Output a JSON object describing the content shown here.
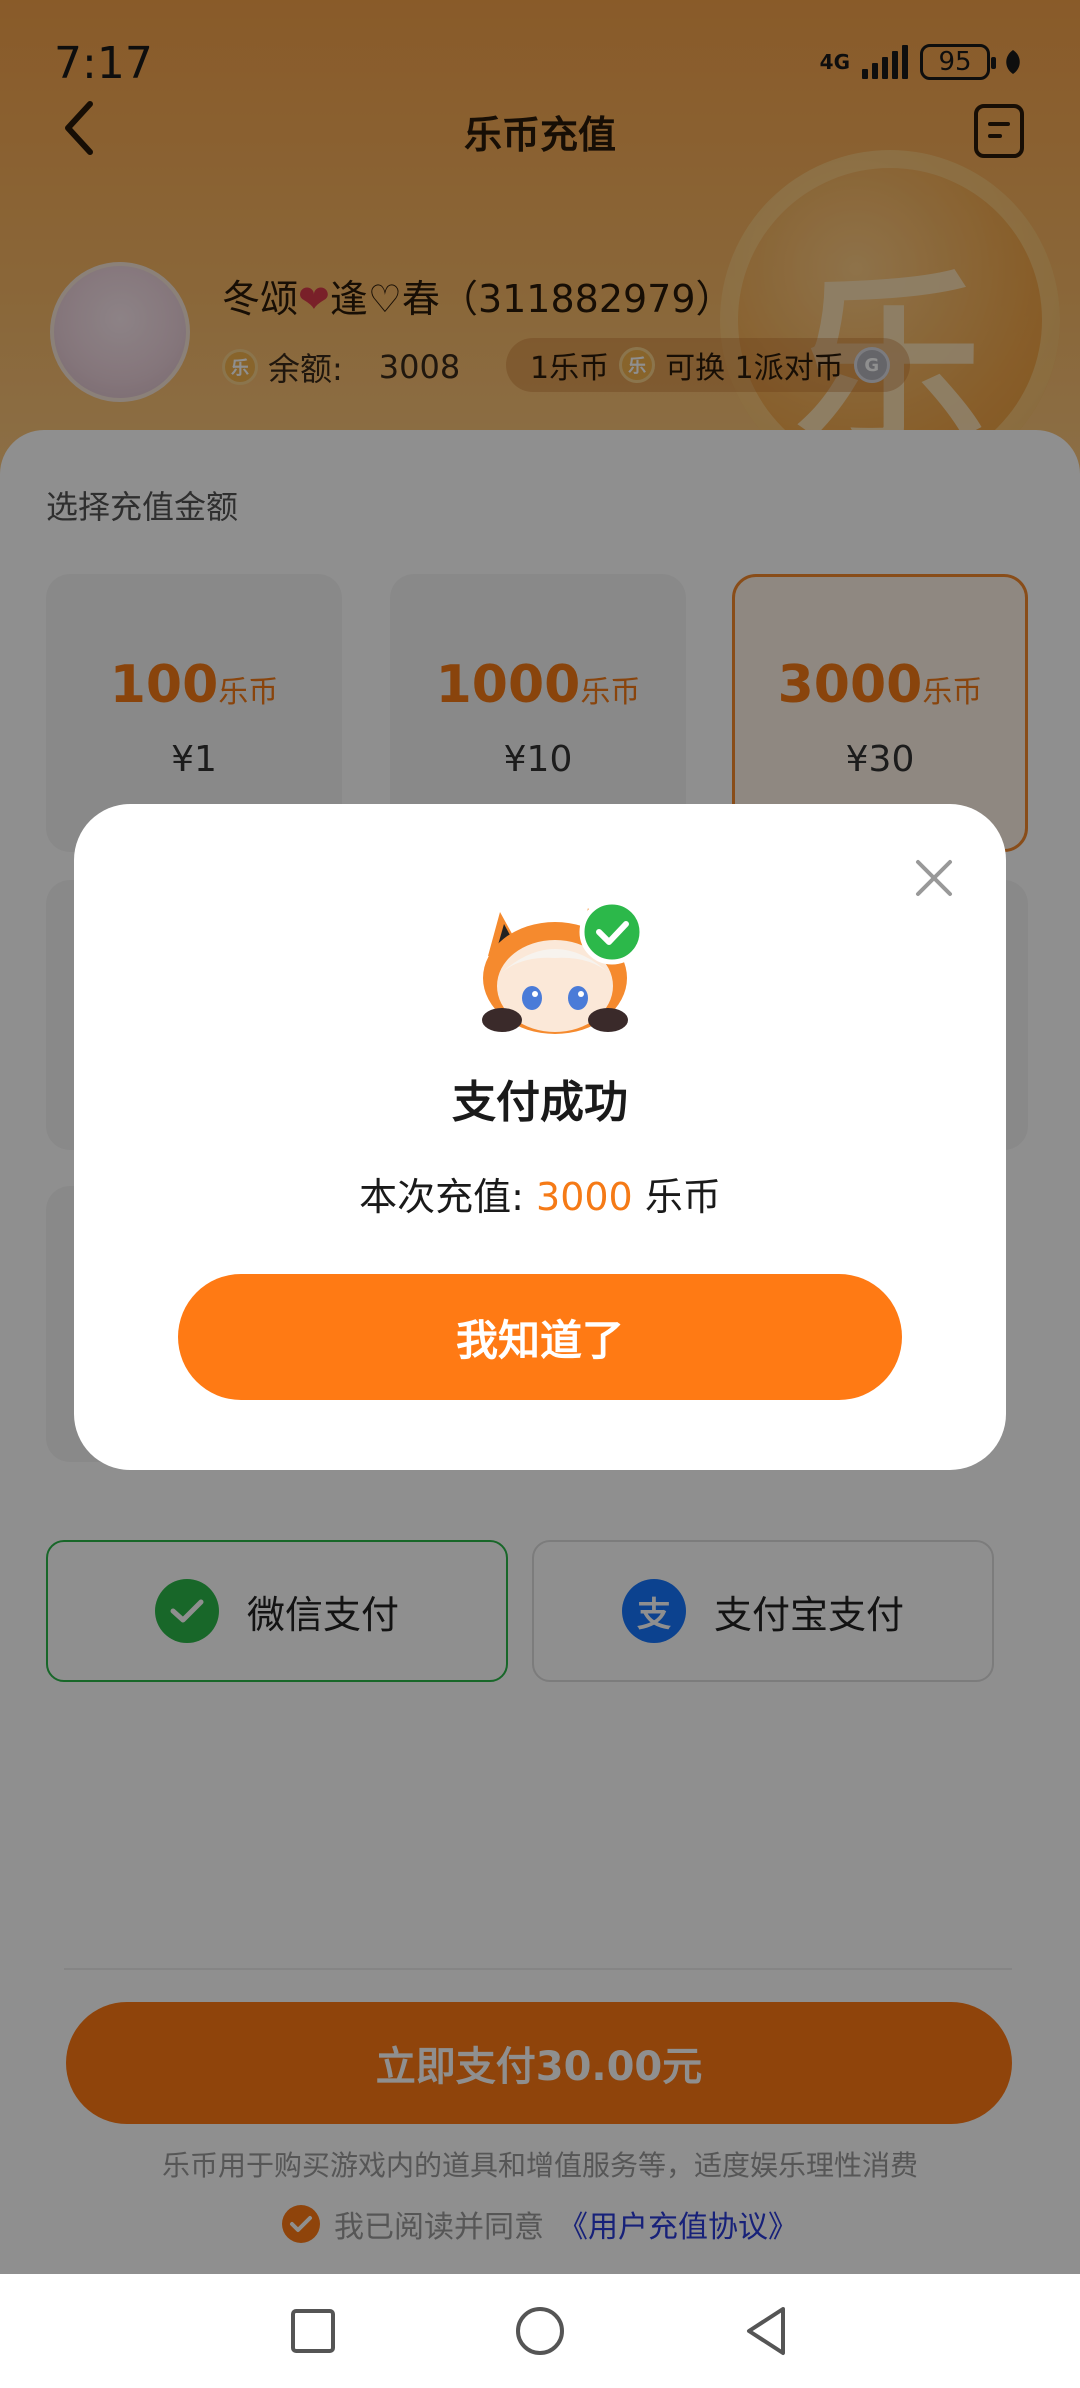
{
  "status_bar": {
    "time": "7:17",
    "network": "4G",
    "battery": "95"
  },
  "header": {
    "title": "乐币充值",
    "coin_symbol": "乐"
  },
  "user": {
    "name_part1": "冬颂",
    "heart": "❤",
    "name_part2": "逢♡春",
    "uid": "（311882979）",
    "coin_glyph": "乐",
    "balance_label": "余额:",
    "balance_value": "3008",
    "exchange_rate_left": "1乐币",
    "exchange_rate_right": "可换 1派对币",
    "party_coin_glyph": "G"
  },
  "recharge": {
    "section_title": "选择充值金额",
    "packages": [
      {
        "coins": "100",
        "unit": "乐币",
        "price": "¥1",
        "selected": false
      },
      {
        "coins": "1000",
        "unit": "乐币",
        "price": "¥10",
        "selected": false
      },
      {
        "coins": "3000",
        "unit": "乐币",
        "price": "¥30",
        "selected": true
      }
    ]
  },
  "payment_methods": [
    {
      "label": "微信支付",
      "icon": "wechat-pay-icon",
      "color": "#2cb84a",
      "selected": true
    },
    {
      "label": "支付宝支付",
      "icon": "alipay-icon",
      "color": "#1677ff",
      "selected": false
    }
  ],
  "footer": {
    "pay_button": "立即支付30.00元",
    "notice": "乐币用于购买游戏内的道具和增值服务等，适度娱乐理性消费",
    "agree_text": "我已阅读并同意",
    "agreement_link": "《用户充值协议》"
  },
  "modal": {
    "title": "支付成功",
    "desc_prefix": "本次充值:",
    "desc_amount": "3000",
    "desc_unit": "乐币",
    "button": "我知道了"
  },
  "colors": {
    "accent": "#ff7a14",
    "coin_text": "#f57a16",
    "wechat_green": "#2cb84a",
    "alipay_blue": "#1677ff",
    "link_blue": "#2a3bd8"
  }
}
